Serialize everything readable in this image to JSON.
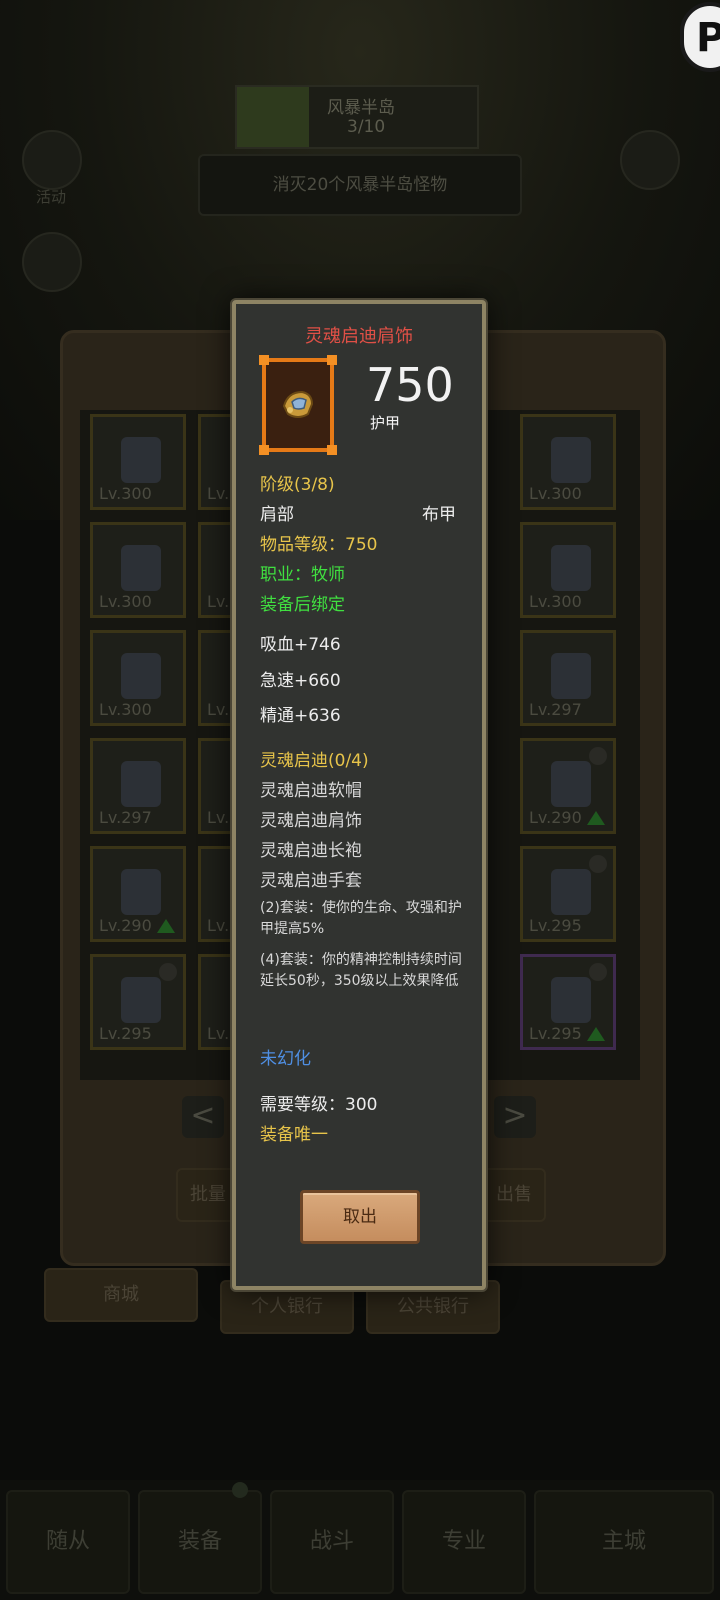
{
  "background": {
    "quest": {
      "title": "风暴半岛",
      "progress": "3/10",
      "task": "消灭20个风暴半岛怪物"
    },
    "side_icons": [
      "活动",
      "",
      ""
    ],
    "bank_buttons": {
      "left": "批量",
      "right": "出售",
      "personal_bank": "个人银行",
      "public_bank": "公共银行",
      "store": "商城"
    },
    "nav": {
      "prev": "<",
      "next": ">"
    },
    "slots": [
      {
        "lv": "Lv.300"
      },
      {
        "lv": "Lv."
      },
      {
        "lv": "Lv.300"
      },
      {
        "lv": "Lv.300"
      },
      {
        "lv": "Lv."
      },
      {
        "lv": "Lv.300"
      },
      {
        "lv": "Lv.300"
      },
      {
        "lv": "Lv."
      },
      {
        "lv": "Lv.297"
      },
      {
        "lv": "Lv.297"
      },
      {
        "lv": "Lv."
      },
      {
        "lv": "Lv.290"
      },
      {
        "lv": "Lv.290"
      },
      {
        "lv": "Lv."
      },
      {
        "lv": "Lv.295"
      },
      {
        "lv": "Lv.295"
      },
      {
        "lv": "Lv."
      },
      {
        "lv": "Lv.295"
      }
    ],
    "bottom_tabs": [
      "随从",
      "装备",
      "战斗",
      "专业",
      "主城"
    ]
  },
  "tooltip": {
    "title": "灵魂启迪肩饰",
    "icon": "shoulder-armor-icon",
    "armor_value": "750",
    "armor_label": "护甲",
    "tier": "阶级(3/8)",
    "slot": "肩部",
    "material": "布甲",
    "item_level": "物品等级：750",
    "class": "职业：牧师",
    "bind": "装备后绑定",
    "stats": [
      "吸血+746",
      "急速+660",
      "精通+636"
    ],
    "set_name": "灵魂启迪(0/4)",
    "set_items": [
      "灵魂启迪软帽",
      "灵魂启迪肩饰",
      "灵魂启迪长袍",
      "灵魂启迪手套"
    ],
    "set_bonus_2": "(2)套装：使你的生命、攻强和护甲提高5%",
    "set_bonus_4": "(4)套装：你的精神控制持续时间延长50秒，350级以上效果降低",
    "transmog": "未幻化",
    "required_level": "需要等级：300",
    "unique": "装备唯一",
    "cancel_label": "取出"
  }
}
